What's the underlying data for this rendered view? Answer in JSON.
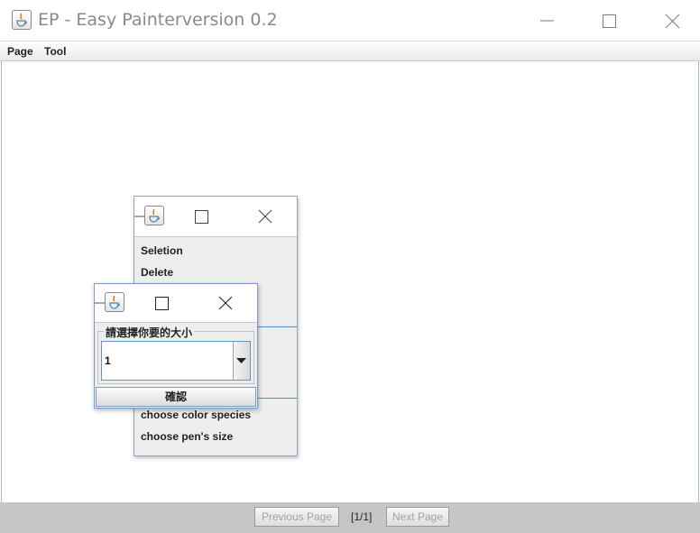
{
  "window": {
    "title": "EP - Easy Painterversion 0.2",
    "icon": "java-cup-icon",
    "controls": [
      "minimize-icon",
      "maximize-icon",
      "close-icon"
    ]
  },
  "menubar": {
    "items": [
      "Page",
      "Tool"
    ]
  },
  "tool_window": {
    "items": [
      "Seletion",
      "Delete",
      "choose color species",
      "choose pen's size"
    ]
  },
  "size_dialog": {
    "group_label": "請選擇你要的大小",
    "selected_size": "1",
    "confirm_label": "確認"
  },
  "footer": {
    "previous_label": "Previous Page",
    "page_indicator": "[1/1]",
    "next_label": "Next Page"
  },
  "colors": {
    "accent": "#5f86b5",
    "footer_bg": "#c6c6c6"
  }
}
